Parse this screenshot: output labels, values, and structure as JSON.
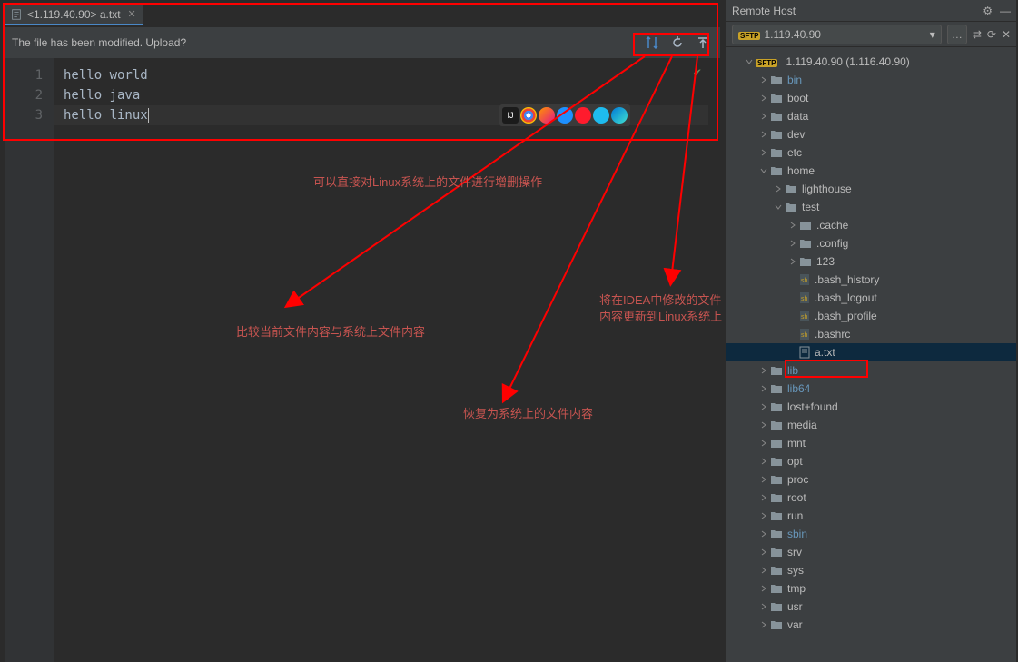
{
  "tab": {
    "title": "<1.119.40.90> a.txt"
  },
  "upload_bar": {
    "message": "The file has been modified. Upload?"
  },
  "code": {
    "lines": [
      "hello world",
      "hello java",
      "hello linux"
    ],
    "line_numbers": [
      "1",
      "2",
      "3"
    ]
  },
  "annotations": {
    "top": "可以直接对Linux系统上的文件进行增删操作",
    "left": "比较当前文件内容与系统上文件内容",
    "mid": "恢复为系统上的文件内容",
    "right_a": "将在IDEA中修改的文件",
    "right_b": "内容更新到Linux系统上"
  },
  "panel": {
    "title": "Remote Host",
    "server": "1.119.40.90",
    "root": "1.119.40.90 (1.116.40.90)"
  },
  "tree": [
    {
      "d": 1,
      "exp": true,
      "type": "root",
      "label": "1.119.40.90 (1.116.40.90)"
    },
    {
      "d": 2,
      "exp": false,
      "type": "folder",
      "label": "bin",
      "blue": true
    },
    {
      "d": 2,
      "exp": false,
      "type": "folder",
      "label": "boot"
    },
    {
      "d": 2,
      "exp": false,
      "type": "folder",
      "label": "data"
    },
    {
      "d": 2,
      "exp": false,
      "type": "folder",
      "label": "dev"
    },
    {
      "d": 2,
      "exp": false,
      "type": "folder",
      "label": "etc"
    },
    {
      "d": 2,
      "exp": true,
      "type": "folder",
      "label": "home"
    },
    {
      "d": 3,
      "exp": false,
      "type": "folder",
      "label": "lighthouse"
    },
    {
      "d": 3,
      "exp": true,
      "type": "folder",
      "label": "test"
    },
    {
      "d": 4,
      "exp": false,
      "type": "folder",
      "label": ".cache"
    },
    {
      "d": 4,
      "exp": false,
      "type": "folder",
      "label": ".config"
    },
    {
      "d": 4,
      "exp": false,
      "type": "folder",
      "label": "123"
    },
    {
      "d": 4,
      "type": "file",
      "icon": "sh",
      "label": ".bash_history"
    },
    {
      "d": 4,
      "type": "file",
      "icon": "sh",
      "label": ".bash_logout"
    },
    {
      "d": 4,
      "type": "file",
      "icon": "sh",
      "label": ".bash_profile"
    },
    {
      "d": 4,
      "type": "file",
      "icon": "sh",
      "label": ".bashrc"
    },
    {
      "d": 4,
      "type": "file",
      "icon": "txt",
      "label": "a.txt",
      "selected": true
    },
    {
      "d": 2,
      "exp": false,
      "type": "folder",
      "label": "lib",
      "blue": true
    },
    {
      "d": 2,
      "exp": false,
      "type": "folder",
      "label": "lib64",
      "blue": true
    },
    {
      "d": 2,
      "exp": false,
      "type": "folder",
      "label": "lost+found"
    },
    {
      "d": 2,
      "exp": false,
      "type": "folder",
      "label": "media"
    },
    {
      "d": 2,
      "exp": false,
      "type": "folder",
      "label": "mnt"
    },
    {
      "d": 2,
      "exp": false,
      "type": "folder",
      "label": "opt"
    },
    {
      "d": 2,
      "exp": false,
      "type": "folder",
      "label": "proc"
    },
    {
      "d": 2,
      "exp": false,
      "type": "folder",
      "label": "root"
    },
    {
      "d": 2,
      "exp": false,
      "type": "folder",
      "label": "run"
    },
    {
      "d": 2,
      "exp": false,
      "type": "folder",
      "label": "sbin",
      "blue": true
    },
    {
      "d": 2,
      "exp": false,
      "type": "folder",
      "label": "srv"
    },
    {
      "d": 2,
      "exp": false,
      "type": "folder",
      "label": "sys"
    },
    {
      "d": 2,
      "exp": false,
      "type": "folder",
      "label": "tmp"
    },
    {
      "d": 2,
      "exp": false,
      "type": "folder",
      "label": "usr"
    },
    {
      "d": 2,
      "exp": false,
      "type": "folder",
      "label": "var"
    }
  ]
}
